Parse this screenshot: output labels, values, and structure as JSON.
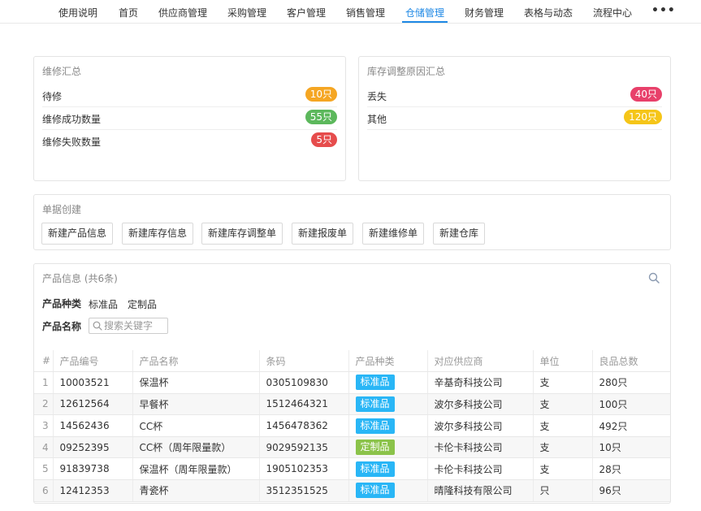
{
  "nav": {
    "items": [
      "使用说明",
      "首页",
      "供应商管理",
      "采购管理",
      "客户管理",
      "销售管理",
      "仓储管理",
      "财务管理",
      "表格与动态",
      "流程中心"
    ],
    "active": "仓储管理",
    "more": "•••"
  },
  "repair": {
    "title": "维修汇总",
    "rows": [
      {
        "label": "待修",
        "value": "10只",
        "color": "#f5a623"
      },
      {
        "label": "维修成功数量",
        "value": "55只",
        "color": "#5cb85c"
      },
      {
        "label": "维修失败数量",
        "value": "5只",
        "color": "#e64c4c"
      }
    ]
  },
  "adjust": {
    "title": "库存调整原因汇总",
    "rows": [
      {
        "label": "丢失",
        "value": "40只",
        "color": "#e8406a"
      },
      {
        "label": "其他",
        "value": "120只",
        "color": "#f5c518"
      }
    ]
  },
  "create": {
    "title": "单据创建",
    "buttons": [
      "新建产品信息",
      "新建库存信息",
      "新建库存调整单",
      "新建报废单",
      "新建维修单",
      "新建仓库"
    ]
  },
  "products": {
    "title": "产品信息 (共6条)",
    "filter_type_label": "产品种类",
    "filter_type_options": [
      "标准品",
      "定制品"
    ],
    "filter_name_label": "产品名称",
    "search_placeholder": "搜索关键字",
    "columns": [
      "#",
      "产品编号",
      "产品名称",
      "条码",
      "产品种类",
      "对应供应商",
      "单位",
      "良品总数"
    ],
    "rows": [
      [
        "1",
        "10003521",
        "保温杯",
        "0305109830",
        "标准品",
        "辛基奇科技公司",
        "支",
        "280只"
      ],
      [
        "2",
        "12612564",
        "早餐杯",
        "1512464321",
        "标准品",
        "波尔多科技公司",
        "支",
        "100只"
      ],
      [
        "3",
        "14562436",
        "CC杯",
        "1456478362",
        "标准品",
        "波尔多科技公司",
        "支",
        "492只"
      ],
      [
        "4",
        "09252395",
        "CC杯（周年限量款）",
        "9029592135",
        "定制品",
        "卡伦卡科技公司",
        "支",
        "10只"
      ],
      [
        "5",
        "91839738",
        "保温杯（周年限量款）",
        "1905102353",
        "标准品",
        "卡伦卡科技公司",
        "支",
        "28只"
      ],
      [
        "6",
        "12412353",
        "青瓷杯",
        "3512351525",
        "标准品",
        "晴隆科技有限公司",
        "只",
        "96只"
      ]
    ],
    "tag_colors": {
      "标准品": "#29b6f6",
      "定制品": "#8bc34a"
    }
  }
}
